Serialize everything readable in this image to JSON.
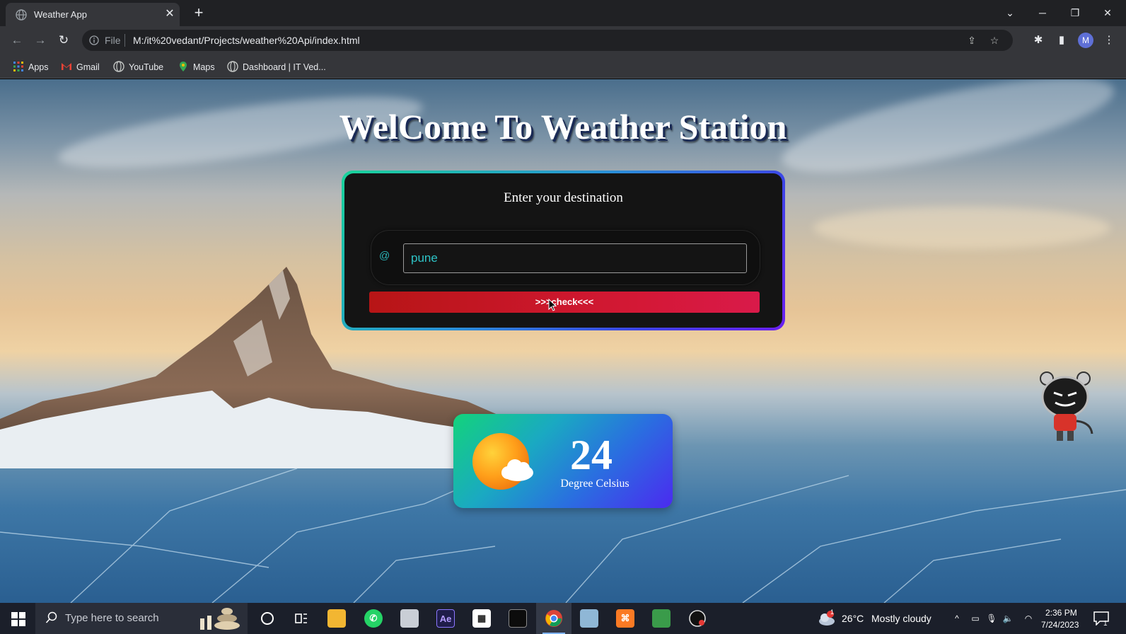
{
  "browser": {
    "tab_title": "Weather App",
    "omnibox_scheme": "File",
    "url": "M:/it%20vedant/Projects/weather%20Api/index.html",
    "avatar_letter": "M",
    "bookmarks": [
      "Apps",
      "Gmail",
      "YouTube",
      "Maps",
      "Dashboard | IT Ved..."
    ]
  },
  "page": {
    "heading": "WelCome To Weather Station",
    "form": {
      "prompt": "Enter your destination",
      "at_symbol": "@",
      "city_value": "pune",
      "button_label": ">>>check<<<"
    },
    "result": {
      "temperature": "24",
      "unit_label": "Degree Celsius"
    }
  },
  "taskbar": {
    "search_placeholder": "Type here to search",
    "weather_temp": "26°C",
    "weather_desc": "Mostly cloudy",
    "time": "2:36 PM",
    "date": "7/24/2023",
    "notification_count": "1",
    "weather_alert_count": "1",
    "apps": [
      "file-explorer",
      "whatsapp",
      "app",
      "after-effects",
      "calendar",
      "terminal",
      "chrome",
      "app",
      "xampp",
      "app",
      "app"
    ]
  },
  "colors": {
    "card_gradient": [
      "#19d39a",
      "#3c45e6",
      "#6b1ff0"
    ],
    "button_gradient": [
      "#b71516",
      "#d91a4a"
    ],
    "input_text": "#2ec4c7",
    "result_gradient": [
      "#13d37b",
      "#4b2af0"
    ]
  }
}
